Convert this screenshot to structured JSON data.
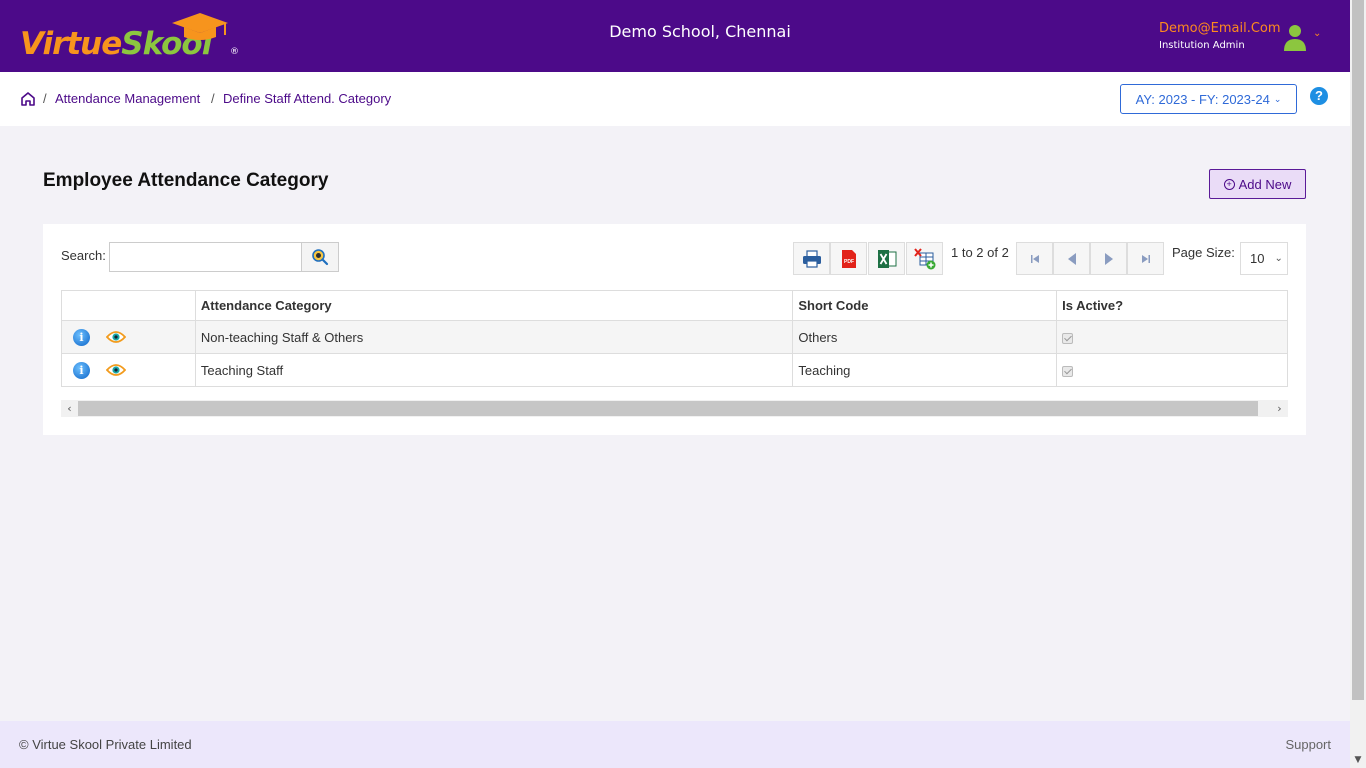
{
  "header": {
    "logo_part1": "Virtue",
    "logo_part2": "Skool",
    "logo_reg": "®",
    "school_name": "Demo School, Chennai",
    "user_email": "Demo@Email.Com",
    "user_role": "Institution Admin",
    "colors": {
      "bar": "#4c0a89",
      "accent": "#ff8a1d"
    }
  },
  "breadcrumb": {
    "items": [
      "Attendance Management",
      "Define Staff Attend. Category"
    ],
    "separator": "/"
  },
  "academic_year": {
    "label": "AY: 2023 - FY: 2023-24"
  },
  "help": {
    "label": "?"
  },
  "page": {
    "title": "Employee Attendance Category",
    "add_button": "Add New"
  },
  "toolbar": {
    "search_label": "Search:",
    "search_value": "",
    "icons": [
      "print-icon",
      "pdf-icon",
      "excel-icon",
      "excel-add-icon"
    ],
    "pager_text": "1 to 2 of 2",
    "page_size_label": "Page Size:",
    "page_size_value": "10"
  },
  "table": {
    "columns": [
      "",
      "Attendance Category",
      "Short Code",
      "Is Active?"
    ],
    "rows": [
      {
        "category": "Non-teaching Staff & Others",
        "short_code": "Others",
        "is_active": true
      },
      {
        "category": "Teaching Staff",
        "short_code": "Teaching",
        "is_active": true
      }
    ],
    "info_glyph": "i"
  },
  "footer": {
    "copyright": "© Virtue Skool Private Limited",
    "support": "Support"
  }
}
